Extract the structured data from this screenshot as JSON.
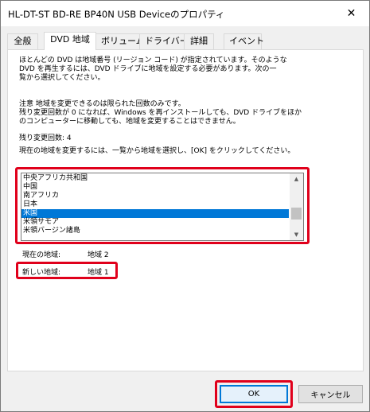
{
  "window": {
    "title": "HL-DT-ST BD-RE BP40N USB Deviceのプロパティ",
    "close_glyph": "✕"
  },
  "tabs": [
    {
      "label": "全般"
    },
    {
      "label": "DVD 地域"
    },
    {
      "label": "ボリューム"
    },
    {
      "label": "ドライバー"
    },
    {
      "label": "詳細"
    },
    {
      "label": "イベント"
    }
  ],
  "panel": {
    "intro_line1": "ほとんどの DVD は地域番号 (リージョン コード) が指定されています。そのような",
    "intro_line2": "DVD を再生するには、DVD ドライブに地域を設定する必要があります。次の一",
    "intro_line3": "覧から選択してください。",
    "note_line1": "注意   地域を変更できるのは限られた回数のみです。",
    "note_line2": "残り変更回数が 0 になれば、Windows を再インストールしても、DVD ドライブをほか",
    "note_line3": "のコンピューターに移動しても、地域を変更することはできません。",
    "remaining_label": "残り変更回数: 4",
    "instruction": "現在の地域を変更するには、一覧から地域を選択し、[OK] をクリックしてください。",
    "list_items": [
      {
        "label": "中央アフリカ共和国"
      },
      {
        "label": "中国"
      },
      {
        "label": "南アフリカ"
      },
      {
        "label": "日本"
      },
      {
        "label": "米国"
      },
      {
        "label": "米領サモア"
      },
      {
        "label": "米領バージン諸島"
      }
    ],
    "selected_index": 4,
    "current_region_label": "現在の地域:",
    "current_region_value": "地域 2",
    "new_region_label": "新しい地域:",
    "new_region_value": "地域 1"
  },
  "buttons": {
    "ok": "OK",
    "cancel": "キャンセル"
  },
  "colors": {
    "highlight": "#e0001b",
    "selection": "#0078d7"
  }
}
